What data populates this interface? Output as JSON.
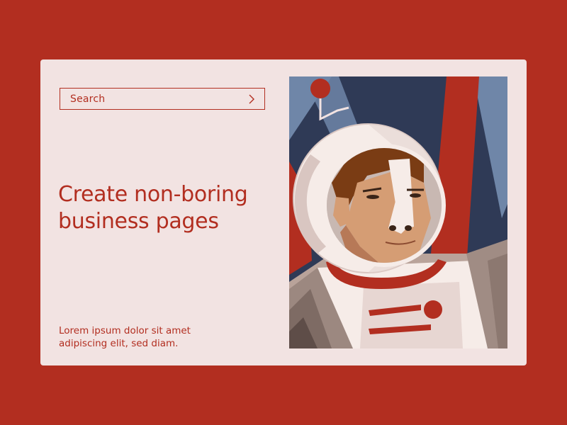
{
  "search": {
    "placeholder": "Search"
  },
  "hero": {
    "headline": "Create non-boring business pages",
    "body": "Lorem ipsum dolor sit amet adipiscing elit, sed diam."
  },
  "icons": {
    "search_submit": "chevron-right-icon",
    "illustration": "astronaut-illustration"
  },
  "colors": {
    "background": "#b22e20",
    "card": "#f2e3e2",
    "accent": "#b22e20",
    "space": "#2f3a56",
    "steel_blue": "#6f86a8"
  }
}
